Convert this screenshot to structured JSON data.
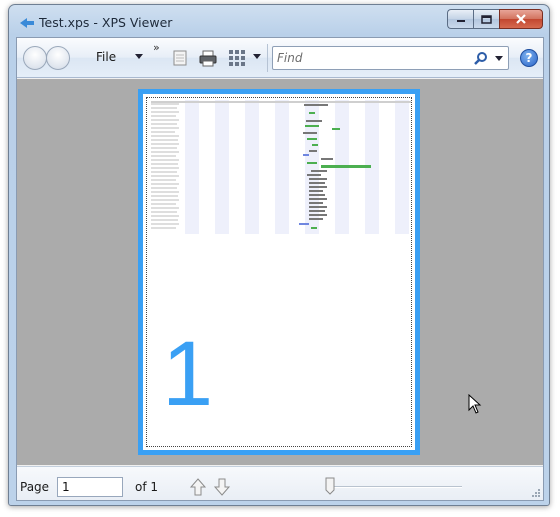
{
  "window": {
    "title": "Test.xps - XPS Viewer"
  },
  "toolbar": {
    "file_label": "File",
    "more_chevron": "»",
    "find_placeholder": "Find",
    "help_label": "?"
  },
  "document": {
    "page_number_large": "1"
  },
  "statusbar": {
    "page_label": "Page",
    "page_value": "1",
    "of_label": "of 1",
    "zoom_position": 0.0
  },
  "icons": {
    "app": "xps-viewer-icon",
    "back": "back-arrow-icon",
    "forward": "forward-arrow-icon",
    "permissions": "document-icon",
    "print": "printer-icon",
    "view": "grid-view-icon",
    "search": "search-icon",
    "help": "help-icon",
    "prev_page": "arrow-up-icon",
    "next_page": "arrow-down-icon"
  },
  "colors": {
    "page_highlight": "#3aa0f4",
    "viewport_bg": "#ababab",
    "gantt_green": "#4caf50",
    "gantt_blue": "#6f86e0"
  }
}
